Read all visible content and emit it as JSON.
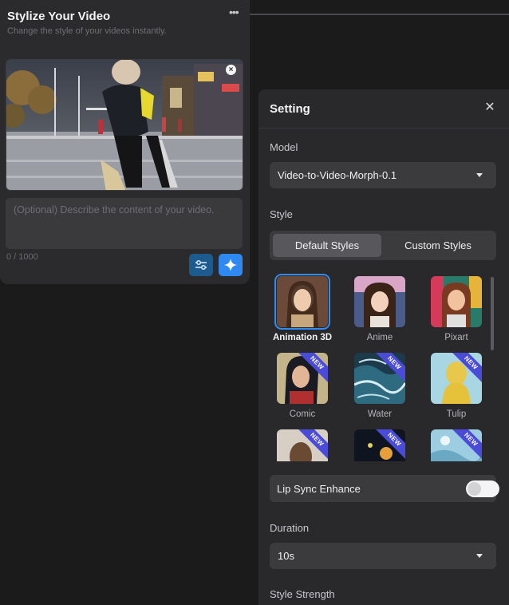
{
  "left_card": {
    "title": "Stylize Your Video",
    "subtitle": "Change the style of your videos instantly.",
    "prompt_placeholder": "(Optional) Describe the content of your video.",
    "prompt_value": "",
    "char_count": "0 / 1000",
    "icons": {
      "more": "more-horizontal-icon",
      "remove_video": "close-icon",
      "settings": "sliders-icon",
      "generate": "sparkle-icon"
    }
  },
  "setting_panel": {
    "title": "Setting",
    "model_label": "Model",
    "model_value": "Video-to-Video-Morph-0.1",
    "style_label": "Style",
    "tabs": [
      {
        "label": "Default Styles",
        "active": true
      },
      {
        "label": "Custom Styles",
        "active": false
      }
    ],
    "styles": [
      {
        "name": "Animation 3D",
        "selected": true,
        "new": false
      },
      {
        "name": "Anime",
        "selected": false,
        "new": false
      },
      {
        "name": "Pixart",
        "selected": false,
        "new": false
      },
      {
        "name": "Comic",
        "selected": false,
        "new": true
      },
      {
        "name": "Water",
        "selected": false,
        "new": true
      },
      {
        "name": "Tulip",
        "selected": false,
        "new": true
      },
      {
        "name": "",
        "selected": false,
        "new": true
      },
      {
        "name": "",
        "selected": false,
        "new": true
      },
      {
        "name": "",
        "selected": false,
        "new": true
      }
    ],
    "new_badge": "NEW",
    "lip_sync_label": "Lip Sync Enhance",
    "lip_sync_enabled": false,
    "duration_label": "Duration",
    "duration_value": "10s",
    "style_strength_label": "Style Strength"
  },
  "colors": {
    "accent": "#2e8af0",
    "panel_bg": "#29292b",
    "card_bg": "#2b2b2d",
    "badge": "#4b4bd9"
  }
}
